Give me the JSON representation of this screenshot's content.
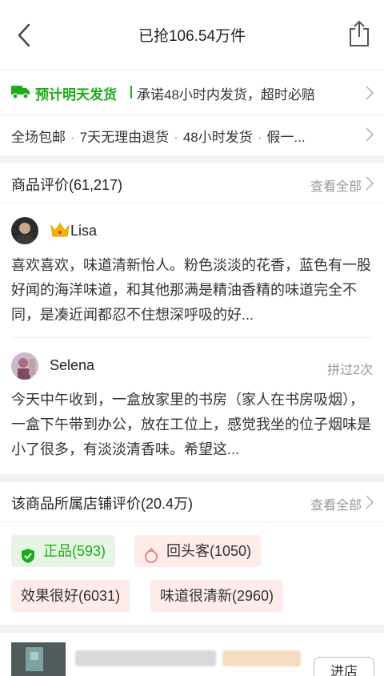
{
  "header": {
    "title": "已抢106.54万件"
  },
  "shipping": {
    "highlight": "预计明天发货",
    "promise": "承诺48小时内发货，超时必赔"
  },
  "services": {
    "items": [
      "全场包邮",
      "7天无理由退货",
      "48小时发货",
      "假一..."
    ]
  },
  "reviews": {
    "title": "商品评价(61,217)",
    "see_all": "查看全部",
    "items": [
      {
        "user": "Lisa",
        "badge": "",
        "text": "喜欢喜欢，味道清新怡人。粉色淡淡的花香，蓝色有一股好闻的海洋味道，和其他那满是精油香精的味道完全不同，是凑近闻都忍不住想深呼吸的好..."
      },
      {
        "user": "Selena",
        "badge": "拼过2次",
        "text": "今天中午收到，一盒放家里的书房（家人在书房吸烟），一盒下午带到办公，放在工位上，感觉我坐的位子烟味是小了很多，有淡淡清香味。希望这..."
      }
    ]
  },
  "shop_reviews": {
    "title": "该商品所属店铺评价(20.4万)",
    "see_all": "查看全部",
    "tags": [
      "正品(593)",
      "回头客(1050)",
      "效果很好(6031)",
      "味道很清新(2960)"
    ]
  },
  "store": {
    "enter_label": "进店"
  },
  "colors": {
    "accent_green": "#1aad19",
    "tag_green_bg": "#e7f6e4",
    "tag_pink_bg": "#fdece9"
  },
  "icons": [
    "back-arrow-icon",
    "share-icon",
    "truck-icon",
    "chevron-right-icon",
    "crown-icon",
    "shield-check-icon",
    "ring-icon"
  ]
}
